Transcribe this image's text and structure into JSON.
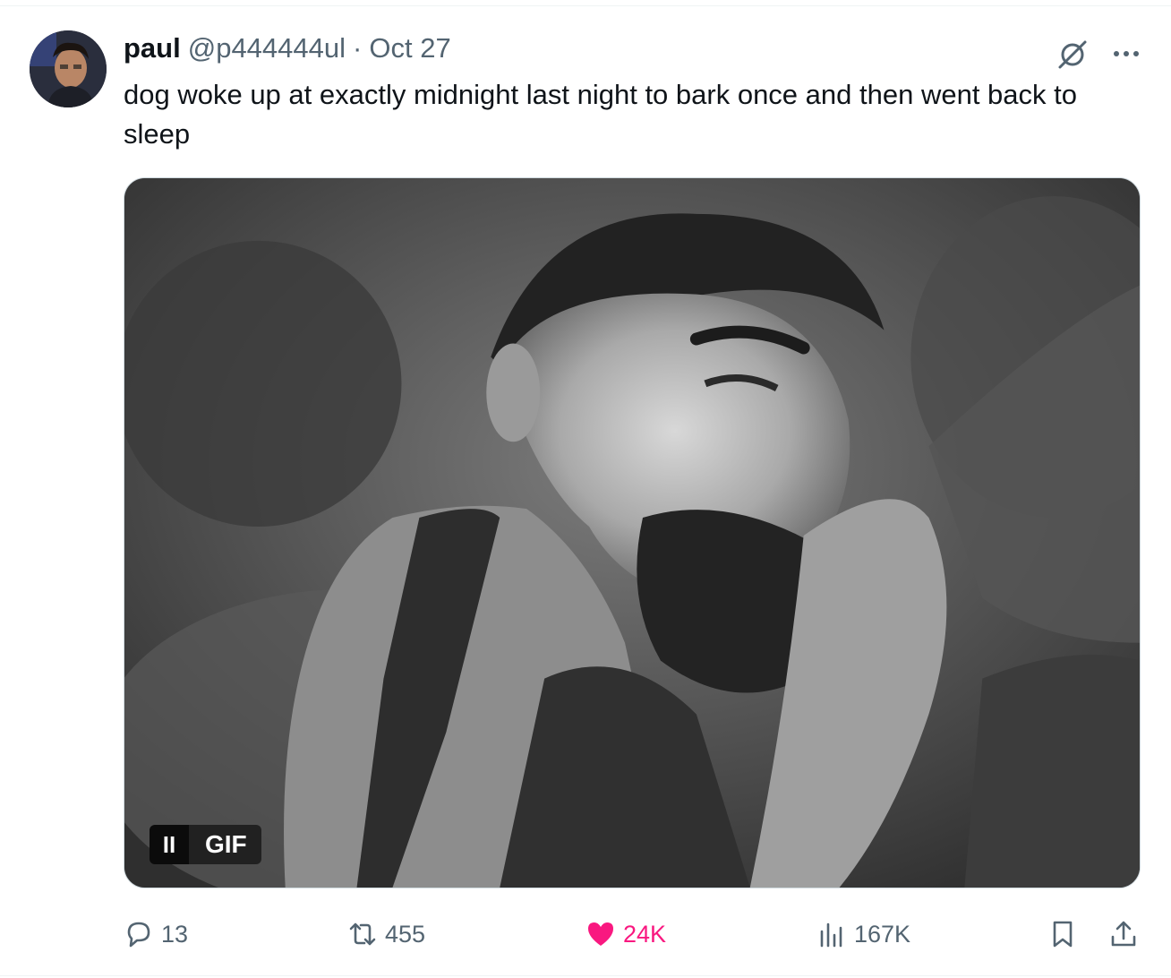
{
  "tweet": {
    "author_name": "paul",
    "handle": "@p444444ul",
    "separator": "·",
    "date": "Oct 27",
    "text": "dog woke up at exactly midnight last night to bark once and then went back to sleep"
  },
  "media": {
    "badge": "GIF",
    "pause_glyph": "II"
  },
  "actions": {
    "replies": "13",
    "reposts": "455",
    "likes": "24K",
    "views": "167K"
  },
  "icons": {
    "grok": "grok-icon",
    "more": "more-icon",
    "reply": "reply-icon",
    "repost": "repost-icon",
    "like": "heart-icon",
    "views": "views-icon",
    "bookmark": "bookmark-icon",
    "share": "share-icon"
  },
  "colors": {
    "text": "#0f1419",
    "secondary": "#536471",
    "like": "#f91880"
  }
}
